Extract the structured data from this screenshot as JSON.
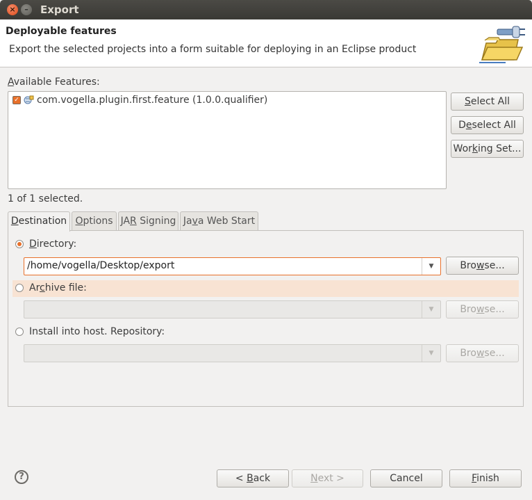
{
  "window": {
    "title": "Export"
  },
  "header": {
    "title": "Deployable features",
    "description": "Export the selected projects into a form suitable for deploying in an Eclipse product"
  },
  "features": {
    "label": "Available Features:",
    "items": [
      {
        "label": "com.vogella.plugin.first.feature (1.0.0.qualifier)",
        "checked": true
      }
    ],
    "selected_count": "1 of 1 selected.",
    "buttons": {
      "select_all": "Select All",
      "deselect_all": "Deselect All",
      "working_set": "Working Set..."
    }
  },
  "tabs": [
    {
      "label": "Destination",
      "active": true
    },
    {
      "label": "Options",
      "active": false
    },
    {
      "label": "JAR Signing",
      "active": false
    },
    {
      "label": "Java Web Start",
      "active": false
    }
  ],
  "destination": {
    "directory": {
      "label": "Directory:",
      "value": "/home/vogella/Desktop/export",
      "selected": true,
      "browse": "Browse..."
    },
    "archive": {
      "label": "Archive file:",
      "value": "",
      "selected": false,
      "browse": "Browse..."
    },
    "repository": {
      "label": "Install into host. Repository:",
      "value": "",
      "selected": false,
      "browse": "Browse..."
    }
  },
  "footer": {
    "back": "< Back",
    "next": "Next >",
    "cancel": "Cancel",
    "finish": "Finish"
  },
  "colors": {
    "accent": "#e8702a",
    "titlebar": "#3c3b37",
    "highlight_row": "#f8e3d3"
  },
  "icons": {
    "close": "close-icon",
    "minimize": "minimize-icon",
    "help": "help-icon",
    "wizard": "export-folder-icon"
  }
}
